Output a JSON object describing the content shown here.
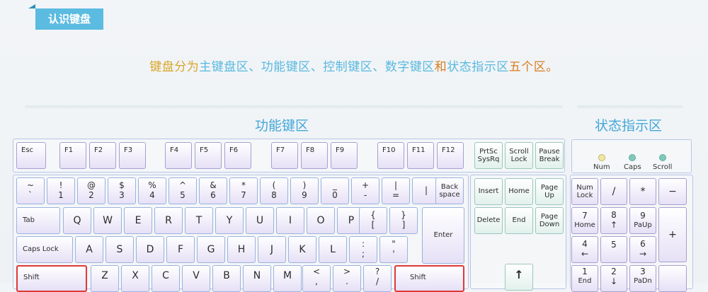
{
  "header": {
    "tag": "认识键盘"
  },
  "subtitle": {
    "p1": "键盘分为",
    "p2": "主键盘区、功能键区、控制键区、数字键区",
    "p3": "和",
    "p4": "状态指示区",
    "p5": "五个区。"
  },
  "sections": {
    "function": "功能键区",
    "status": "状态指示区"
  },
  "indicators": [
    "Num",
    "Caps",
    "Scroll"
  ],
  "fkeys": [
    "Esc",
    "F1",
    "F2",
    "F3",
    "F4",
    "F5",
    "F6",
    "F7",
    "F8",
    "F9",
    "F10",
    "F11",
    "F12"
  ],
  "syskeys": [
    [
      "PrtSc",
      "SysRq"
    ],
    [
      "Scroll",
      "Lock"
    ],
    [
      "Pause",
      "Break"
    ]
  ],
  "numrow": [
    [
      "~",
      "`"
    ],
    [
      "!",
      "1"
    ],
    [
      "@",
      "2"
    ],
    [
      "$",
      "3"
    ],
    [
      "%",
      "4"
    ],
    [
      "^",
      "5"
    ],
    [
      "&",
      "6"
    ],
    [
      "*",
      "7"
    ],
    [
      "(",
      "8"
    ],
    [
      ")",
      "9"
    ],
    [
      "_",
      "0"
    ],
    [
      "+",
      "-"
    ],
    [
      "|",
      "="
    ],
    [
      "Back",
      "space"
    ]
  ],
  "tab_row": {
    "tab": "Tab",
    "letters": [
      "Q",
      "W",
      "E",
      "R",
      "T",
      "Y",
      "U",
      "I",
      "O",
      "P"
    ],
    "punct": [
      [
        "{",
        "["
      ],
      [
        "}",
        "]"
      ]
    ]
  },
  "caps_row": {
    "caps": "Caps Lock",
    "letters": [
      "A",
      "S",
      "D",
      "F",
      "G",
      "H",
      "J",
      "K",
      "L"
    ],
    "punct": [
      [
        ":",
        ";"
      ],
      [
        "\"",
        "'"
      ]
    ],
    "enter": "Enter"
  },
  "shift_row": {
    "shift_left": "Shift",
    "letters": [
      "Z",
      "X",
      "C",
      "V",
      "B",
      "N",
      "M"
    ],
    "punct": [
      [
        "<",
        ","
      ],
      [
        ">",
        "."
      ],
      [
        "?",
        "/"
      ]
    ],
    "shift_right": "Shift"
  },
  "control": {
    "insert": "Insert",
    "home": "Home",
    "pageup": [
      "Page",
      "Up"
    ],
    "delete": "Delete",
    "end": "End",
    "pagedown": [
      "Page",
      "Down"
    ],
    "up": "↑"
  },
  "numpad": {
    "numlock": [
      "Num",
      "Lock"
    ],
    "slash": "/",
    "star": "*",
    "minus": "−",
    "plus": "+",
    "n7": [
      "7",
      "Home"
    ],
    "n8": [
      "8",
      "↑"
    ],
    "n9": [
      "9",
      "PaUp"
    ],
    "n4": [
      "4",
      "←"
    ],
    "n5": [
      "5",
      ""
    ],
    "n6": [
      "6",
      "→"
    ],
    "n1": [
      "1",
      "End"
    ],
    "n2": [
      "2",
      "↓"
    ],
    "n3": [
      "3",
      "PaDn"
    ]
  }
}
